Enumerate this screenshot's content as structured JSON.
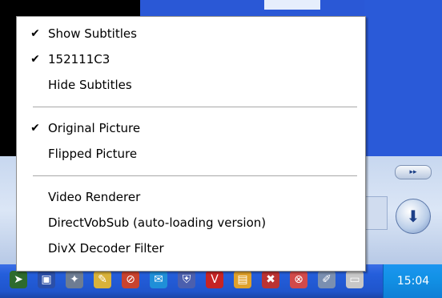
{
  "context_menu": {
    "groups": [
      [
        {
          "label": "Show Subtitles",
          "checked": true
        },
        {
          "label": "152111C3",
          "checked": true
        },
        {
          "label": "Hide Subtitles",
          "checked": false
        }
      ],
      [
        {
          "label": "Original Picture",
          "checked": true
        },
        {
          "label": "Flipped Picture",
          "checked": false
        }
      ],
      [
        {
          "label": "Video Renderer",
          "checked": false
        },
        {
          "label": "DirectVobSub (auto-loading version)",
          "checked": false
        },
        {
          "label": "DivX Decoder Filter",
          "checked": false
        }
      ]
    ],
    "check_glyph": "✔"
  },
  "taskbar": {
    "clock": "15:04",
    "tray_icons": [
      "arrow-icon",
      "monitor-icon",
      "satellite-icon",
      "feather-icon",
      "blocked-icon",
      "messenger-icon",
      "shield-icon",
      "antivirus-icon",
      "folder-icon",
      "network-error-icon",
      "security-alert-icon",
      "pencil-icon",
      "display-icon"
    ]
  },
  "player": {
    "ff_label": "▸▸",
    "round_button_glyph": "⬇"
  },
  "colors": {
    "taskbar_blue": "#245edb",
    "clock_blue": "#1292e6",
    "menu_bg": "#ffffff"
  }
}
